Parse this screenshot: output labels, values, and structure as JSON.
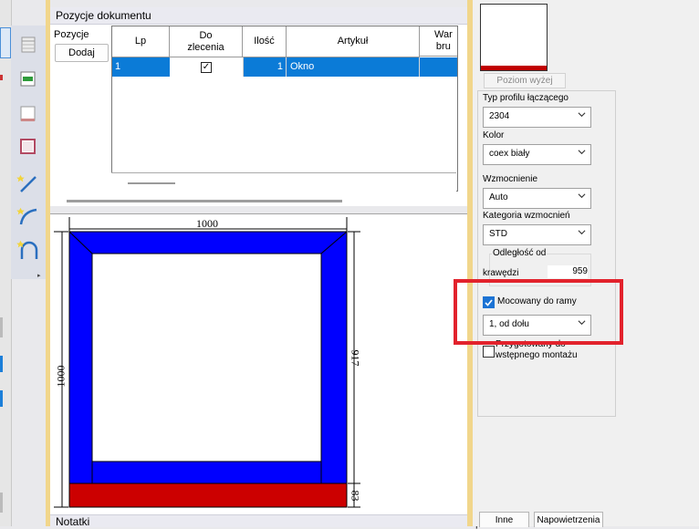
{
  "positions_panel": {
    "title": "Pozycje dokumentu",
    "pin_icon": "pin-icon",
    "menu_icon": "dropdown-arrow-icon",
    "section_label": "Pozycje",
    "add_button": "Dodaj",
    "columns": [
      "Lp",
      "Do\nzlecenia",
      "Ilość",
      "Artykuł",
      "War\nbru"
    ],
    "rows": [
      {
        "lp": "1",
        "do_zlecenia": true,
        "ilosc": "1",
        "artykul": "Okno",
        "wartosc": ""
      }
    ],
    "selection_color": "#0b7bd7"
  },
  "drawing": {
    "top_dimension": "1000",
    "left_dimension": "1000",
    "right_dimension": "917",
    "bottom_dimension": "83",
    "frame_color": "#0000ff",
    "profile_color": "#cc0000"
  },
  "notes_panel": {
    "title": "Notatki"
  },
  "properties": {
    "up_level_button": "Poziom wyżej",
    "profile_type_label": "Typ profilu łączącego",
    "profile_type_value": "2304",
    "color_label": "Kolor",
    "color_value": "coex biały",
    "reinforcement_label": "Wzmocnienie",
    "reinforcement_value": "Auto",
    "reinforcement_category_label": "Kategoria wzmocnień",
    "reinforcement_category_value": "STD",
    "distance_group_label": "Odległość od",
    "edge_label": "krawędzi",
    "edge_value": "959",
    "mounted_to_frame_label": "Mocowany do ramy",
    "mounted_to_frame_checked": true,
    "mount_position_value": "1, od dołu",
    "premount_label_line1": "Przygotowany do",
    "premount_label_line2": "wstępnego montażu",
    "premount_checked": false
  },
  "bottom_tabs": [
    "Inne",
    "Napowietrzenia"
  ],
  "highlight_color": "#e2222c"
}
